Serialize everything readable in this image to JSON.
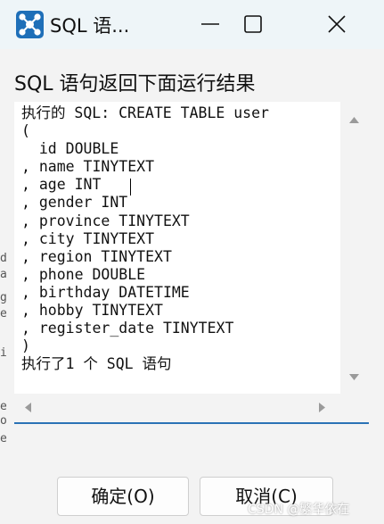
{
  "window": {
    "title": "SQL 语...",
    "icon": "network-app-icon",
    "controls": [
      "minimize-icon",
      "maximize-icon",
      "close-icon"
    ]
  },
  "dialog": {
    "prompt": "SQL 语句返回下面运行结果",
    "result_lines": [
      "执行的 SQL: CREATE TABLE user",
      "(",
      "  id DOUBLE",
      ", name TINYTEXT",
      ", age INT",
      ", gender INT",
      ", province TINYTEXT",
      ", city TINYTEXT",
      ", region TINYTEXT",
      ", phone DOUBLE",
      ", birthday DATETIME",
      ", hobby TINYTEXT",
      ", register_date TINYTEXT",
      ")",
      "执行了1 个 SQL 语句"
    ],
    "buttons": {
      "ok": "确定(O)",
      "cancel": "取消(C)"
    }
  },
  "background_strip": [
    "d",
    "a",
    "g",
    "e",
    "i",
    "e",
    "o",
    "e"
  ],
  "watermark": "CSDN @繁华依在",
  "colors": {
    "titlebar": "#eef5f8",
    "dialog_bg": "#f3f3f3",
    "accent": "#2a72b5",
    "app_icon": "#1e6fb8"
  }
}
